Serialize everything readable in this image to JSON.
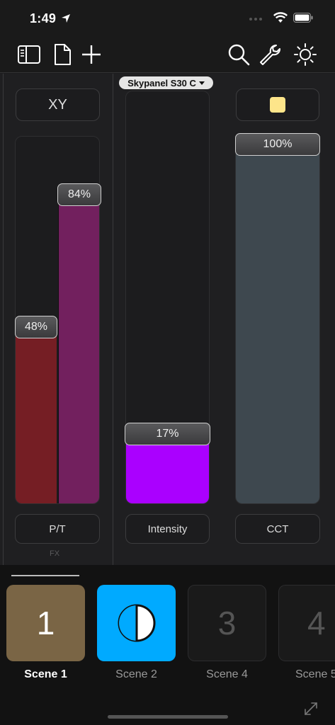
{
  "status": {
    "time": "1:49"
  },
  "fixture": {
    "name": "Skypanel S30 C"
  },
  "columns": {
    "pt": {
      "top_label": "XY",
      "bottom_label": "P/T",
      "pan_value": "48%",
      "tilt_value": "84%",
      "pan_level": 0.48,
      "tilt_level": 0.84,
      "pan_color": "#751e24",
      "tilt_color": "#72205e",
      "fx_label": "FX"
    },
    "intensity": {
      "bottom_label": "Intensity",
      "value": "17%",
      "level": 0.17,
      "color": "#aa00ff"
    },
    "cct": {
      "bottom_label": "CCT",
      "value": "100%",
      "level": 1.0,
      "color": "#3e484f",
      "swatch_color": "#fde58a"
    }
  },
  "scenes": [
    {
      "number": "1",
      "name": "Scene 1",
      "bg": "#7a6545",
      "active": true
    },
    {
      "number": "",
      "name": "Scene 2",
      "bg": "#00aaff",
      "active": false,
      "icon": "half-circle-icon"
    },
    {
      "number": "3",
      "name": "Scene 4",
      "bg": "#1a1a1a",
      "active": false
    },
    {
      "number": "4",
      "name": "Scene 5",
      "bg": "#1a1a1a",
      "active": false
    }
  ],
  "colors": {
    "accent_blue": "#00aaff",
    "handle_border": "#d0d0d0"
  }
}
